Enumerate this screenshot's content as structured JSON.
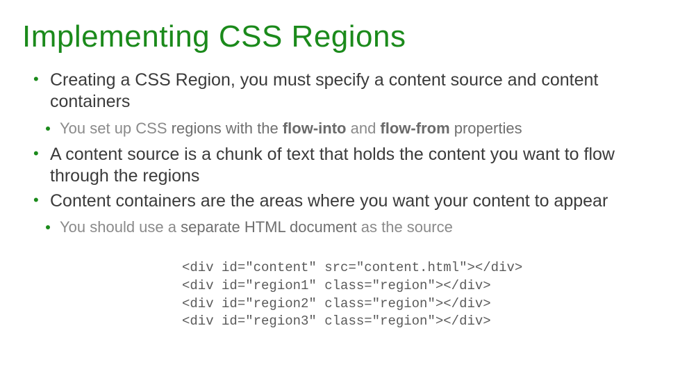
{
  "title": "Implementing CSS Regions",
  "bullets": {
    "b1_pre": "Creating a CSS Region, you must specify a ",
    "b1_h1": "content source",
    "b1_mid": " and ",
    "b1_h2": "content containers",
    "sub1_a": "You set up CSS ",
    "sub1_b": "regions with the ",
    "sub1_flow_into": "flow-into",
    "sub1_and": " and ",
    "sub1_flow_from": "flow-from",
    "sub1_c": " properties",
    "b2": "A content source is a chunk of text that holds the content you want to flow through the regions",
    "b3": "Content containers are the areas where you want your content to appear",
    "sub2_a": "You should use a ",
    "sub2_b": "separate HTML document",
    "sub2_c": " as the source"
  },
  "code": {
    "l1": "<div id=\"content\" src=\"content.html\"></div>",
    "l2": "<div id=\"region1\" class=\"region\"></div>",
    "l3": "<div id=\"region2\" class=\"region\"></div>",
    "l4": "<div id=\"region3\" class=\"region\"></div>"
  }
}
